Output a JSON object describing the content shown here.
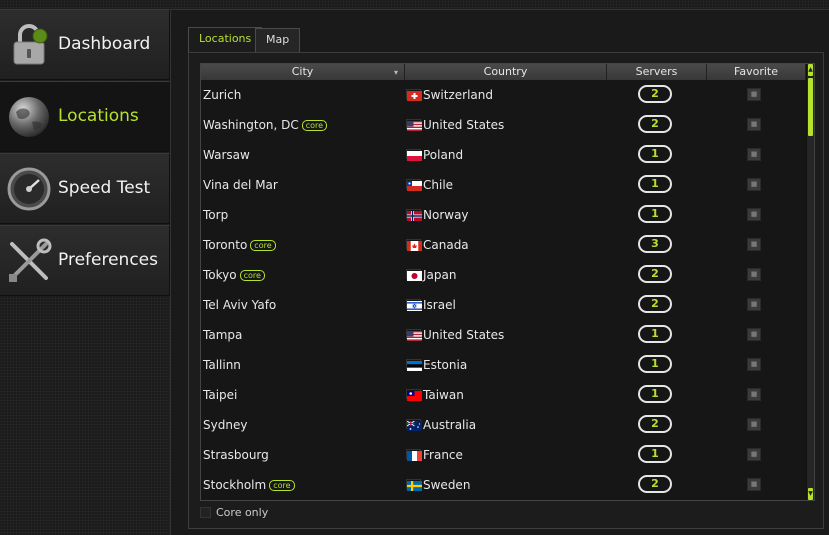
{
  "nav": [
    {
      "label": "Dashboard",
      "icon": "lock-icon",
      "active": false
    },
    {
      "label": "Locations",
      "icon": "globe-icon",
      "active": true
    },
    {
      "label": "Speed Test",
      "icon": "speedometer-icon",
      "active": false
    },
    {
      "label": "Preferences",
      "icon": "wrench-screwdriver-icon",
      "active": false
    }
  ],
  "tabs": [
    {
      "label": "Locations",
      "active": true
    },
    {
      "label": "Map",
      "active": false
    }
  ],
  "table": {
    "columns": {
      "city": "City",
      "country": "Country",
      "servers": "Servers",
      "favorite": "Favorite"
    },
    "badge_text": "core",
    "rows": [
      {
        "city": "Zurich",
        "core": false,
        "country": "Switzerland",
        "flag": "ch",
        "servers": "2"
      },
      {
        "city": "Washington, DC",
        "core": true,
        "country": "United States",
        "flag": "us",
        "servers": "2"
      },
      {
        "city": "Warsaw",
        "core": false,
        "country": "Poland",
        "flag": "pl",
        "servers": "1"
      },
      {
        "city": "Vina del Mar",
        "core": false,
        "country": "Chile",
        "flag": "cl",
        "servers": "1"
      },
      {
        "city": "Torp",
        "core": false,
        "country": "Norway",
        "flag": "no",
        "servers": "1"
      },
      {
        "city": "Toronto",
        "core": true,
        "country": "Canada",
        "flag": "ca",
        "servers": "3"
      },
      {
        "city": "Tokyo",
        "core": true,
        "country": "Japan",
        "flag": "jp",
        "servers": "2"
      },
      {
        "city": "Tel Aviv Yafo",
        "core": false,
        "country": "Israel",
        "flag": "il",
        "servers": "2"
      },
      {
        "city": "Tampa",
        "core": false,
        "country": "United States",
        "flag": "us",
        "servers": "1"
      },
      {
        "city": "Tallinn",
        "core": false,
        "country": "Estonia",
        "flag": "ee",
        "servers": "1"
      },
      {
        "city": "Taipei",
        "core": false,
        "country": "Taiwan",
        "flag": "tw",
        "servers": "1"
      },
      {
        "city": "Sydney",
        "core": false,
        "country": "Australia",
        "flag": "au",
        "servers": "2"
      },
      {
        "city": "Strasbourg",
        "core": false,
        "country": "France",
        "flag": "fr",
        "servers": "1"
      },
      {
        "city": "Stockholm",
        "core": true,
        "country": "Sweden",
        "flag": "se",
        "servers": "2"
      }
    ]
  },
  "core_only_label": "Core only",
  "colors": {
    "accent": "#b6e22e",
    "background": "#1b1b1b",
    "panel": "#1c1c1c"
  }
}
